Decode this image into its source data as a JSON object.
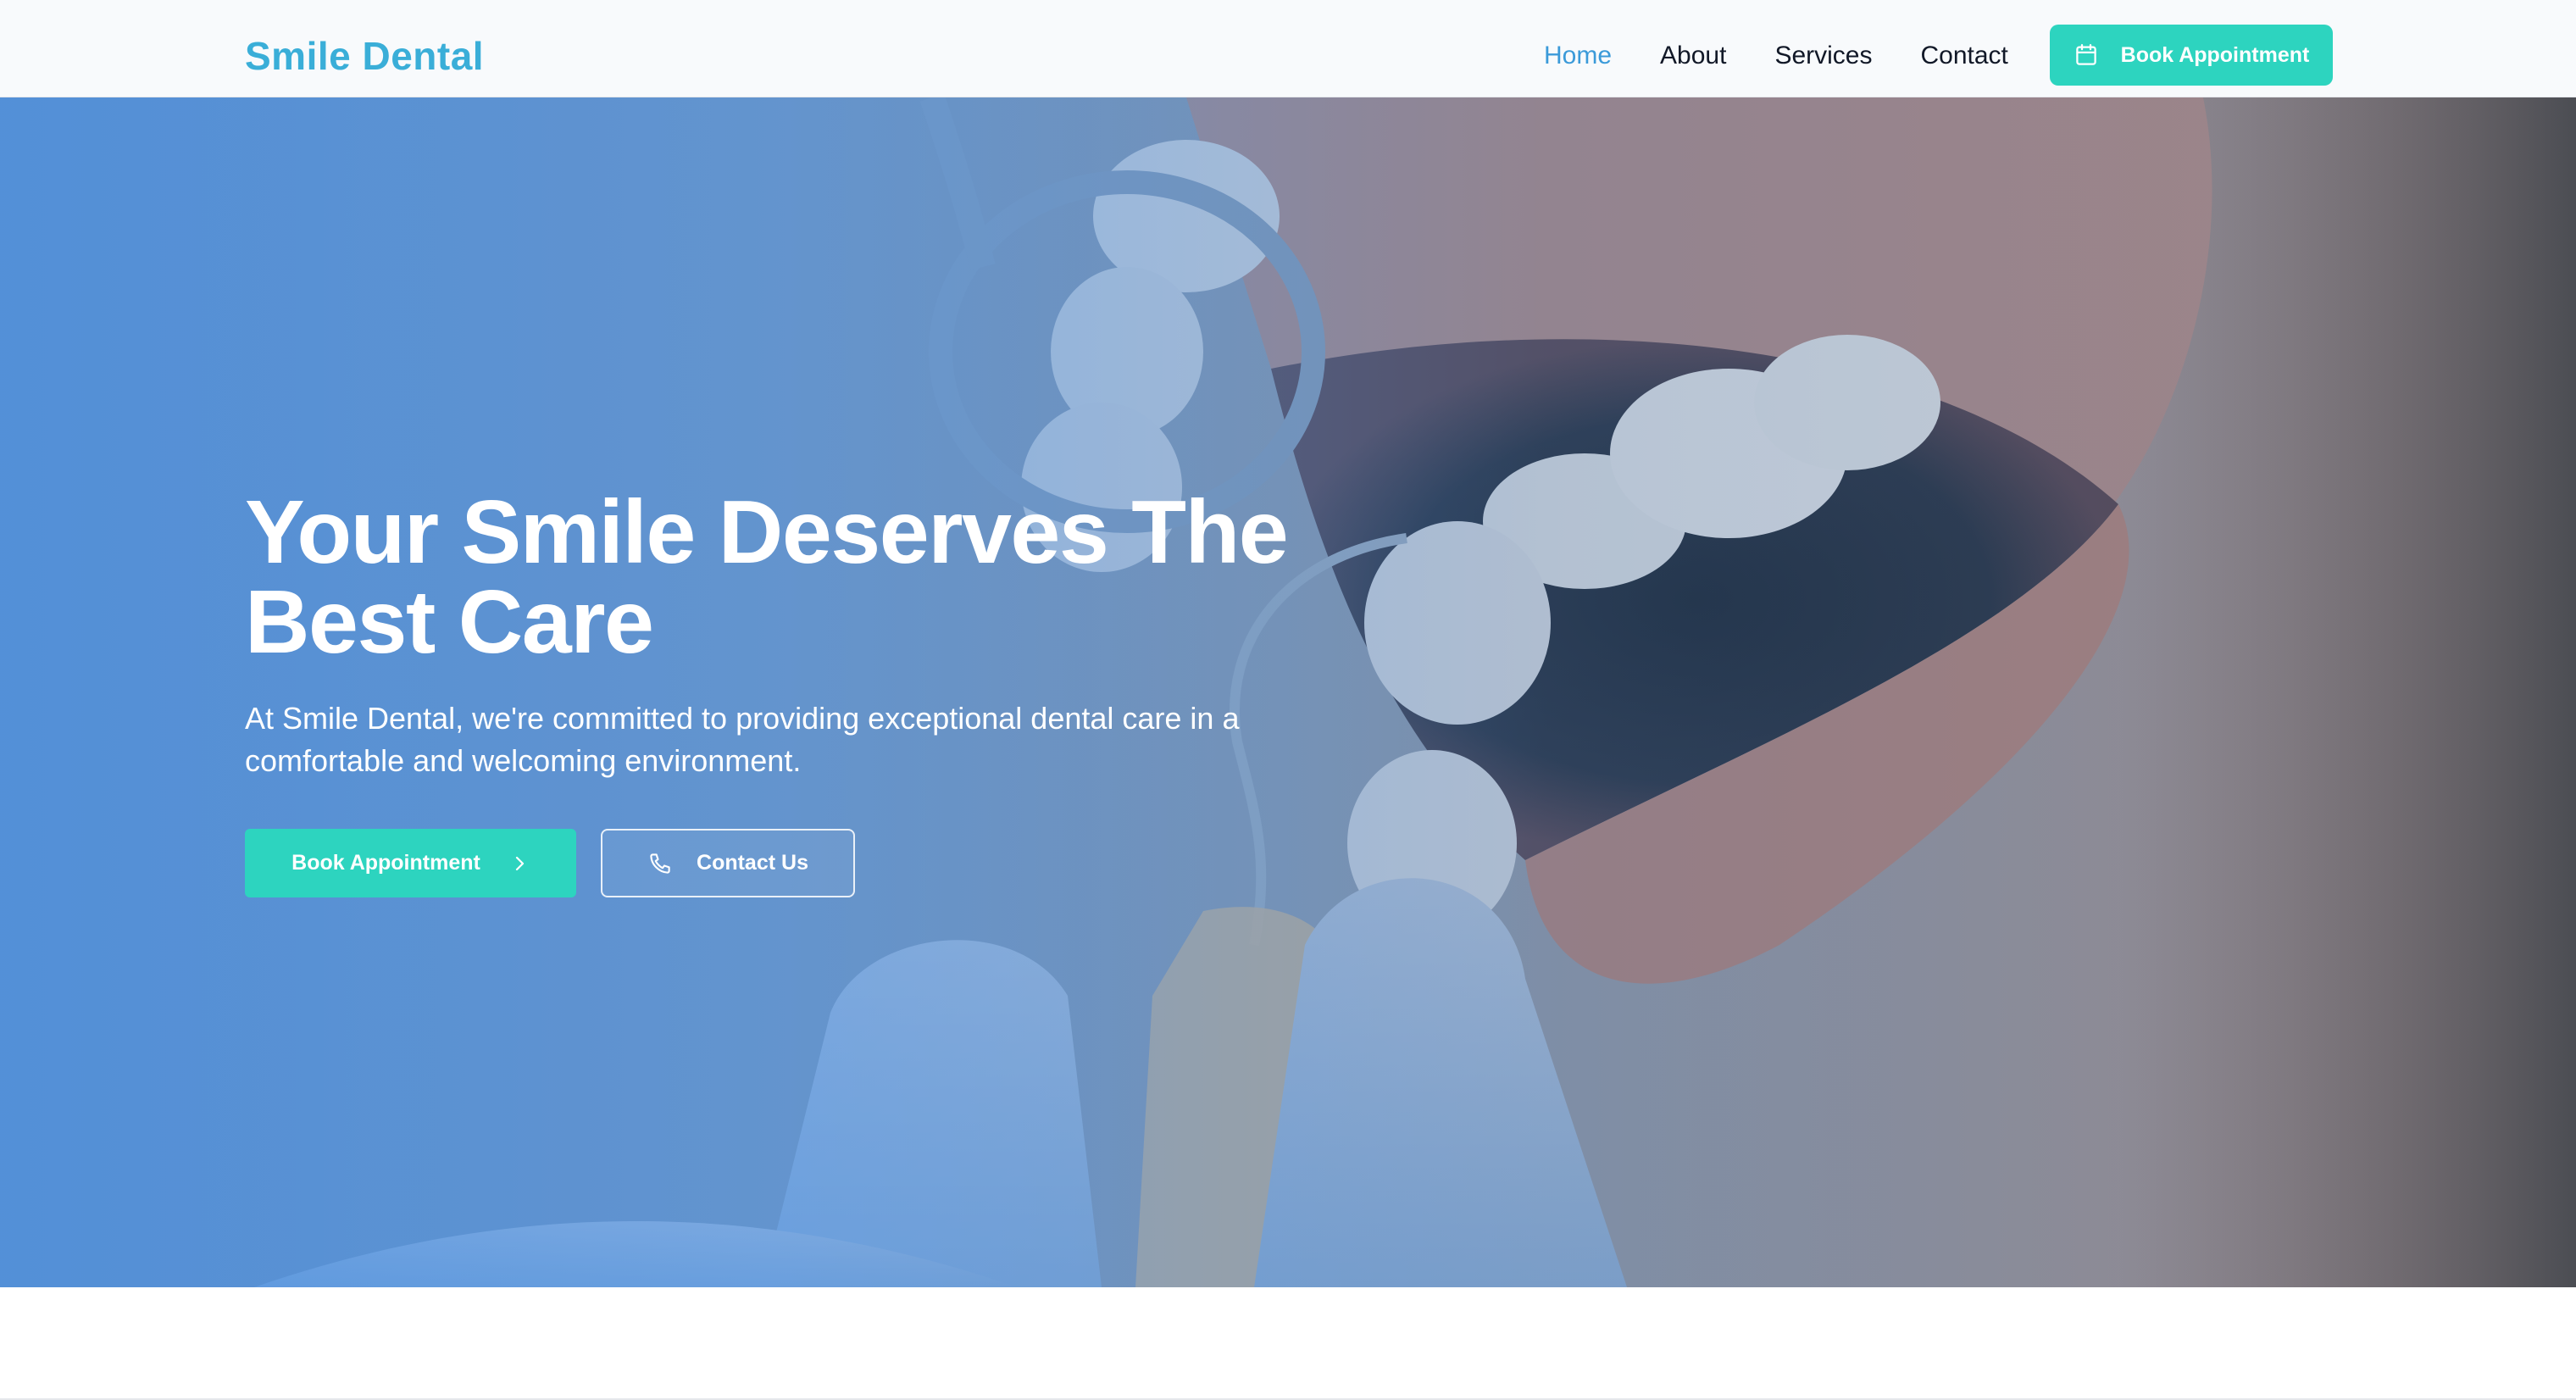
{
  "brand": {
    "name": "Smile Dental"
  },
  "nav": {
    "items": [
      {
        "label": "Home",
        "active": true
      },
      {
        "label": "About",
        "active": false
      },
      {
        "label": "Services",
        "active": false
      },
      {
        "label": "Contact",
        "active": false
      }
    ],
    "cta": {
      "label": "Book Appointment",
      "icon": "calendar-icon"
    }
  },
  "hero": {
    "title_line1": "Your Smile Deserves The",
    "title_line2": "Best Care",
    "subtitle": "At Smile Dental, we're committed to providing exceptional dental care in a comfortable and welcoming environment.",
    "primary_button": {
      "label": "Book Appointment",
      "icon": "chevron-right-icon"
    },
    "secondary_button": {
      "label": "Contact Us",
      "icon": "phone-icon"
    },
    "background": "dental-exam-photo"
  },
  "colors": {
    "brand": "#3aaed8",
    "accent": "#2dd4bf",
    "nav_active": "#3b9ad9",
    "nav_text": "#111827"
  }
}
